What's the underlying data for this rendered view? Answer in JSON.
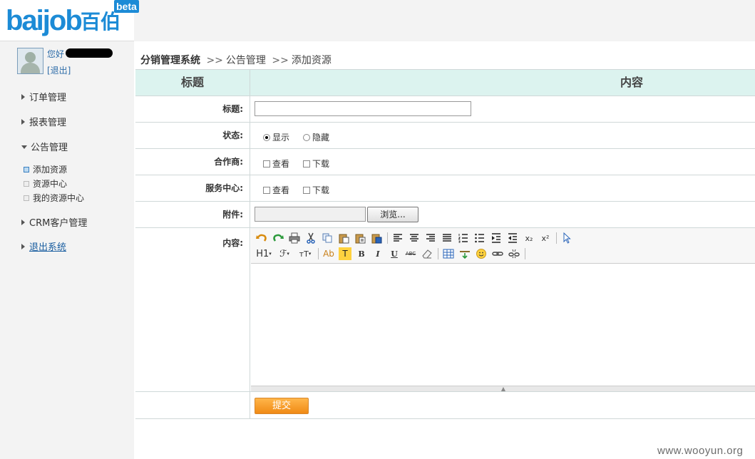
{
  "brand": {
    "wordmark": "baijob",
    "name_cn": "百伯",
    "badge": "beta"
  },
  "user": {
    "greeting": "您好",
    "logout_label": "[退出]"
  },
  "sidebar": {
    "items": [
      {
        "label": "订单管理"
      },
      {
        "label": "报表管理"
      },
      {
        "label": "公告管理"
      },
      {
        "label": "CRM客户管理"
      },
      {
        "label": "退出系统"
      }
    ],
    "sub_items": [
      {
        "label": "添加资源"
      },
      {
        "label": "资源中心"
      },
      {
        "label": "我的资源中心"
      }
    ]
  },
  "breadcrumb": {
    "system": "分销管理系统",
    "sep1": ">>",
    "section": "公告管理",
    "sep2": ">>",
    "page": "添加资源"
  },
  "table": {
    "header_title": "标题",
    "header_content": "内容"
  },
  "form": {
    "title_label": "标题:",
    "title_value": "",
    "status_label": "状态:",
    "status_show": "显示",
    "status_hide": "隐藏",
    "partner_label": "合作商:",
    "partner_view": "查看",
    "partner_download": "下载",
    "service_label": "服务中心:",
    "service_view": "查看",
    "service_download": "下载",
    "attachment_label": "附件:",
    "browse_label": "浏览...",
    "content_label": "内容:",
    "submit_label": "提交"
  },
  "editor": {
    "heading": "H1",
    "font": "ℱ",
    "size": "тT",
    "color": "Ab",
    "highlight": "T",
    "bold": "B",
    "italic": "I",
    "underline": "U",
    "strike": "ABC",
    "sub": "x₂",
    "sup": "x²"
  },
  "colors": {
    "header_bg": "#dcf3ef",
    "submit": "#f08a15",
    "link": "#2d6ca8",
    "sidebar_bg": "#f3f3f3"
  },
  "watermark": "www.wooyun.org"
}
